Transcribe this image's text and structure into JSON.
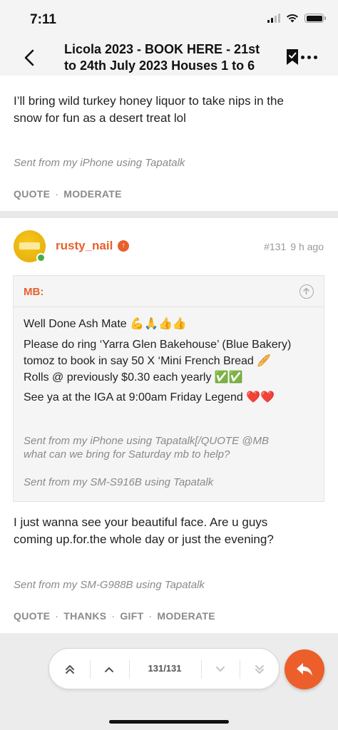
{
  "status_bar": {
    "time": "7:11"
  },
  "nav": {
    "title_line1": "Licola 2023 - BOOK HERE - 21st",
    "title_line2": "to 24th July 2023 Houses 1 to 6"
  },
  "previous_post": {
    "text_line1": "I’ll bring wild turkey honey liquor to take nips in the",
    "text_line2": "snow for fun as a desert treat lol",
    "signature": "Sent from my iPhone using Tapatalk",
    "actions": [
      "QUOTE",
      "MODERATE"
    ]
  },
  "post": {
    "username": "rusty_nail",
    "post_number": "#131",
    "time_ago": "9 h ago",
    "quote": {
      "author": "MB:",
      "lines": [
        "Well Done Ash Mate 💪🙏👍👍",
        "Please do ring ‘Yarra Glen Bakehouse’ (Blue Bakery)",
        "tomoz to book in say 50 X ‘Mini French Bread 🥖",
        "Rolls @ previously $0.30 each yearly ✅✅",
        "See ya at the IGA at 9:00am Friday Legend ❤️❤️"
      ],
      "sig_line1": "Sent from my iPhone using Tapatalk[/QUOTE @MB",
      "sig_line2": "what can we bring for Saturday mb to help?",
      "sig_line3": "Sent from my SM-S916B using Tapatalk"
    },
    "body_line1": "I just wanna see your beautiful face. Are u guys",
    "body_line2": "coming up.for.the whole day or just the evening?",
    "signature": "Sent from my SM-G988B using Tapatalk",
    "actions": [
      "QUOTE",
      "THANKS",
      "GIFT",
      "MODERATE"
    ]
  },
  "pager": {
    "count": "131/131"
  },
  "colors": {
    "accent": "#e8602c",
    "online": "#43b047",
    "muted": "#8a8a8a"
  },
  "icons": [
    "back-arrow-icon",
    "bookmark-check-icon",
    "more-icon",
    "first-page-icon",
    "prev-page-icon",
    "next-page-icon",
    "last-page-icon",
    "reply-icon",
    "collapse-quote-icon",
    "badge-icon"
  ]
}
